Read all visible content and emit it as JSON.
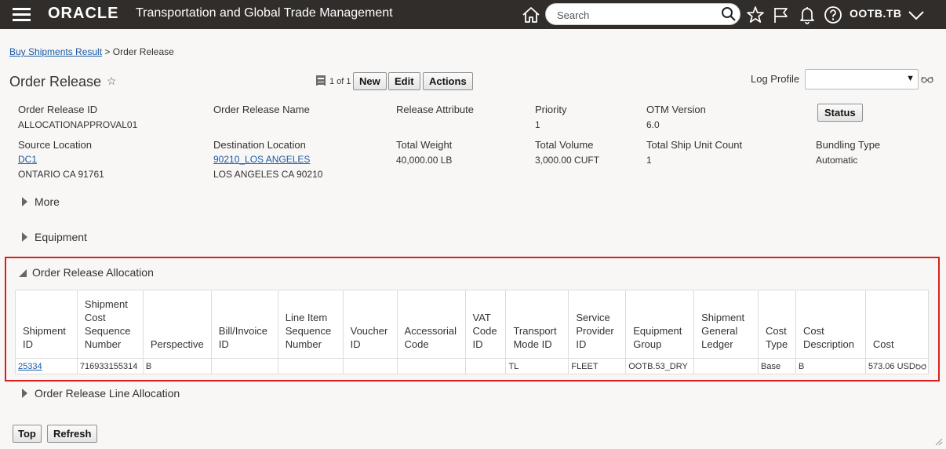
{
  "header": {
    "brand": "ORACLE",
    "app_title": "Transportation and Global Trade Management",
    "search_placeholder": "Search",
    "user": "OOTB.TB"
  },
  "breadcrumb": {
    "parent": "Buy Shipments Result",
    "separator": ">",
    "current": "Order Release"
  },
  "page": {
    "title": "Order Release",
    "pager": "1 of 1"
  },
  "toolbar": {
    "new_label": "New",
    "edit_label": "Edit",
    "actions_label": "Actions",
    "status_label": "Status",
    "log_profile_label": "Log Profile",
    "log_profile_value": ""
  },
  "fields": {
    "order_release_id": {
      "label": "Order Release ID",
      "value": "ALLOCATIONAPPROVAL01"
    },
    "order_release_name": {
      "label": "Order Release Name",
      "value": ""
    },
    "release_attribute": {
      "label": "Release Attribute",
      "value": ""
    },
    "priority": {
      "label": "Priority",
      "value": "1"
    },
    "otm_version": {
      "label": "OTM Version",
      "value": "6.0"
    },
    "source_location": {
      "label": "Source Location",
      "link": "DC1",
      "address": "ONTARIO CA 91761"
    },
    "destination_location": {
      "label": "Destination Location",
      "link": "90210_LOS ANGELES",
      "address": "LOS ANGELES CA 90210"
    },
    "total_weight": {
      "label": "Total Weight",
      "value": "40,000.00 LB"
    },
    "total_volume": {
      "label": "Total Volume",
      "value": "3,000.00 CUFT"
    },
    "total_ship_unit_count": {
      "label": "Total Ship Unit Count",
      "value": "1"
    },
    "bundling_type": {
      "label": "Bundling Type",
      "value": "Automatic"
    }
  },
  "sections": {
    "more": "More",
    "equipment": "Equipment",
    "order_release_allocation": "Order Release Allocation",
    "order_release_line_allocation": "Order Release Line Allocation"
  },
  "allocation_table": {
    "columns": [
      "Shipment ID",
      "Shipment Cost Sequence Number",
      "Perspective",
      "Bill/Invoice ID",
      "Line Item Sequence Number",
      "Voucher ID",
      "Accessorial Code",
      "VAT Code ID",
      "Transport Mode ID",
      "Service Provider ID",
      "Equipment Group",
      "Shipment General Ledger",
      "Cost Type",
      "Cost Description",
      "Cost"
    ],
    "row": {
      "shipment_id": "25334",
      "cost_seq": "716933155314",
      "perspective": "B",
      "bill_invoice_id": "",
      "line_item_seq": "",
      "voucher_id": "",
      "accessorial_code": "",
      "vat_code_id": "",
      "transport_mode_id": "TL",
      "service_provider_id": "FLEET",
      "equipment_group": "OOTB.53_DRY",
      "shipment_gl": "",
      "cost_type": "Base",
      "cost_description": "B",
      "cost": "573.06 USD"
    }
  },
  "footer": {
    "top_label": "Top",
    "refresh_label": "Refresh"
  },
  "colors": {
    "header_bg": "#312d2a",
    "link": "#1a5aa5",
    "highlight": "#d9201e"
  }
}
